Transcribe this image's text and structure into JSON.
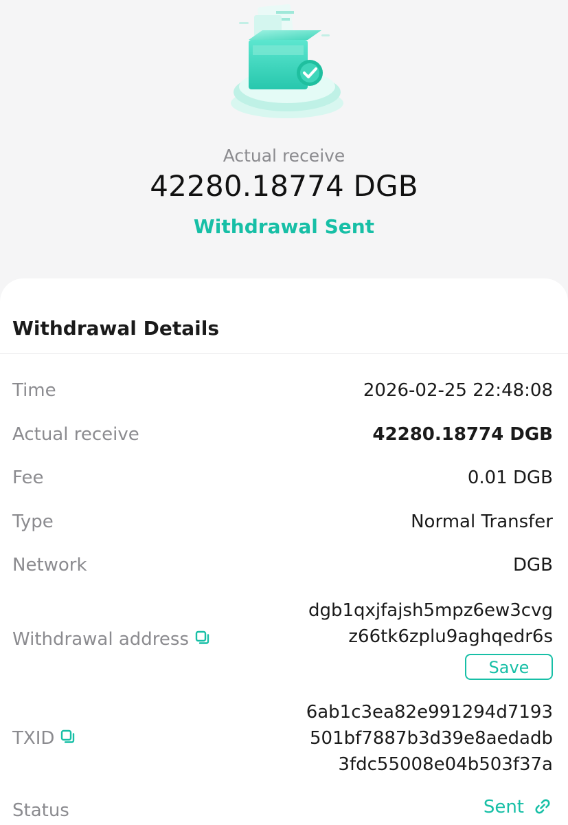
{
  "hero": {
    "illustration_icon": "box-with-checkmark-icon",
    "label": "Actual receive",
    "amount": "42280.18774 DGB",
    "status": "Withdrawal Sent"
  },
  "details": {
    "title": "Withdrawal Details",
    "rows": {
      "time": {
        "label": "Time",
        "value": "2026-02-25 22:48:08"
      },
      "actual_receive": {
        "label": "Actual receive",
        "value": "42280.18774 DGB"
      },
      "fee": {
        "label": "Fee",
        "value": "0.01 DGB"
      },
      "type": {
        "label": "Type",
        "value": "Normal Transfer"
      },
      "network": {
        "label": "Network",
        "value": "DGB"
      },
      "withdrawal_address": {
        "label": "Withdrawal address",
        "value_lines": [
          "dgb1qxjfajsh5mpz6ew3cvg",
          "z66tk6zplu9aghqedr6s"
        ],
        "save_label": "Save"
      },
      "txid": {
        "label": "TXID",
        "value_lines": [
          "6ab1c3ea82e991294d7193",
          "501bf7887b3d39e8aedadb",
          "3fdc55008e04b503f37a"
        ]
      },
      "status": {
        "label": "Status",
        "value": "Sent"
      }
    }
  },
  "colors": {
    "accent": "#17bfa6",
    "background": "#f5f5f6",
    "card": "#ffffff",
    "label": "#8b8b8f",
    "text": "#1a1a1a"
  }
}
